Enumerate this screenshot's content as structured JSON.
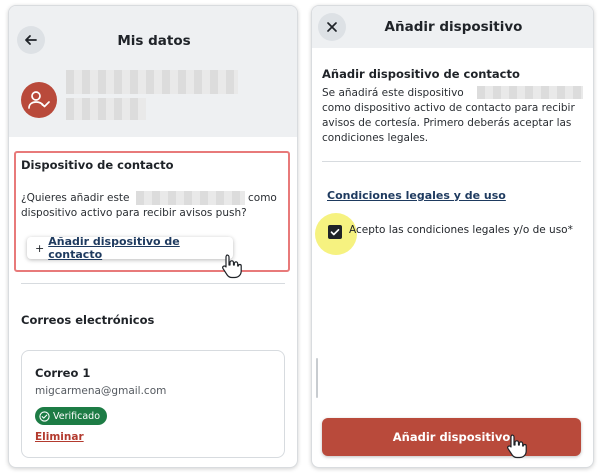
{
  "left_screen": {
    "header": {
      "title": "Mis datos"
    },
    "contact_device_section": {
      "title": "Dispositivo de contacto",
      "question_part1": "¿Quieres añadir este",
      "question_part2": "como",
      "question_part3": "dispositivo activo para recibir avisos push?",
      "add_plus": "+",
      "add_link": "Añadir dispositivo de contacto"
    },
    "emails_section": {
      "title": "Correos electrónicos",
      "card": {
        "title": "Correo 1",
        "email": "migcarmena@gmail.com",
        "badge": "Verificado",
        "delete_link": "Eliminar"
      }
    }
  },
  "right_screen": {
    "header": {
      "title": "Añadir dispositivo"
    },
    "section_title": "Añadir dispositivo de contacto",
    "desc_line1": "Se añadirá este dispositivo",
    "desc_line2": "como dispositivo activo de contacto para recibir",
    "desc_line3": "avisos de cortesía. Primero deberás aceptar las",
    "desc_line4": "condiciones legales.",
    "legal_link": "Condiciones legales y de uso",
    "checkbox_label": "Acepto las condiciones legales y/o de uso*",
    "checkbox_checked": true,
    "primary_button": "Añadir dispositivo"
  },
  "icons": {
    "back": "arrow-left-icon",
    "close": "close-icon",
    "user_check": "user-check-icon",
    "badge_check": "check-circle-icon",
    "checkbox_check": "checkmark-icon",
    "cursor": "hand-pointer-cursor-icon"
  },
  "colors": {
    "accent": "#b94a3b",
    "highlight_border": "#e87a7a",
    "verified_badge": "#1d7c45",
    "link": "#1e3a5f",
    "header_bg": "#eef0f2"
  }
}
